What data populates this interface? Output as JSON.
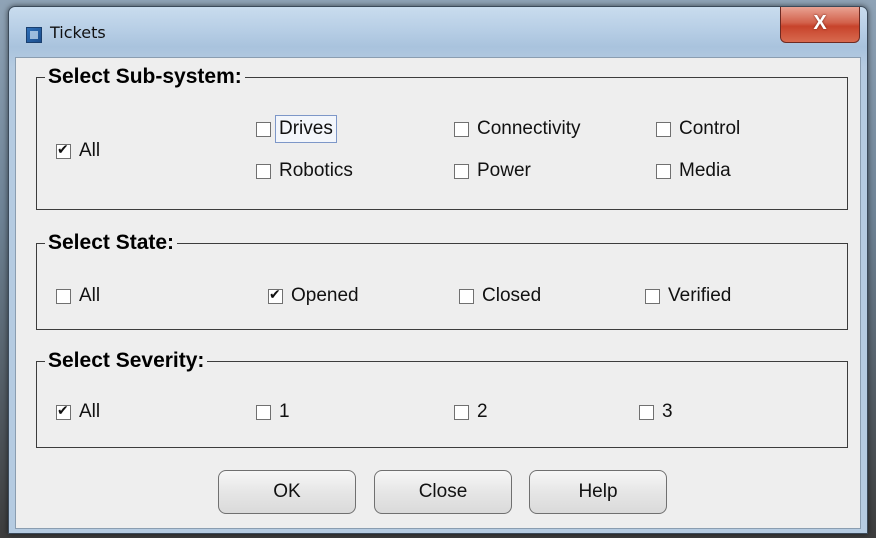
{
  "window": {
    "title": "Tickets",
    "close_glyph": "X"
  },
  "subsystem": {
    "legend": "Select Sub-system:",
    "items": [
      {
        "label": "All",
        "checked": true
      },
      {
        "label": "Drives",
        "checked": false
      },
      {
        "label": "Connectivity",
        "checked": false
      },
      {
        "label": "Control",
        "checked": false
      },
      {
        "label": "Robotics",
        "checked": false
      },
      {
        "label": "Power",
        "checked": false
      },
      {
        "label": "Media",
        "checked": false
      }
    ]
  },
  "state": {
    "legend": "Select State:",
    "items": [
      {
        "label": "All",
        "checked": false
      },
      {
        "label": "Opened",
        "checked": true
      },
      {
        "label": "Closed",
        "checked": false
      },
      {
        "label": "Verified",
        "checked": false
      }
    ]
  },
  "severity": {
    "legend": "Select Severity:",
    "items": [
      {
        "label": "All",
        "checked": true
      },
      {
        "label": "1",
        "checked": false
      },
      {
        "label": "2",
        "checked": false
      },
      {
        "label": "3",
        "checked": false
      }
    ]
  },
  "buttons": {
    "ok": "OK",
    "close": "Close",
    "help": "Help"
  },
  "colors": {
    "title_bar": "#b8cfe6",
    "close_button": "#c7432b",
    "dialog_bg": "#eeeeee"
  }
}
